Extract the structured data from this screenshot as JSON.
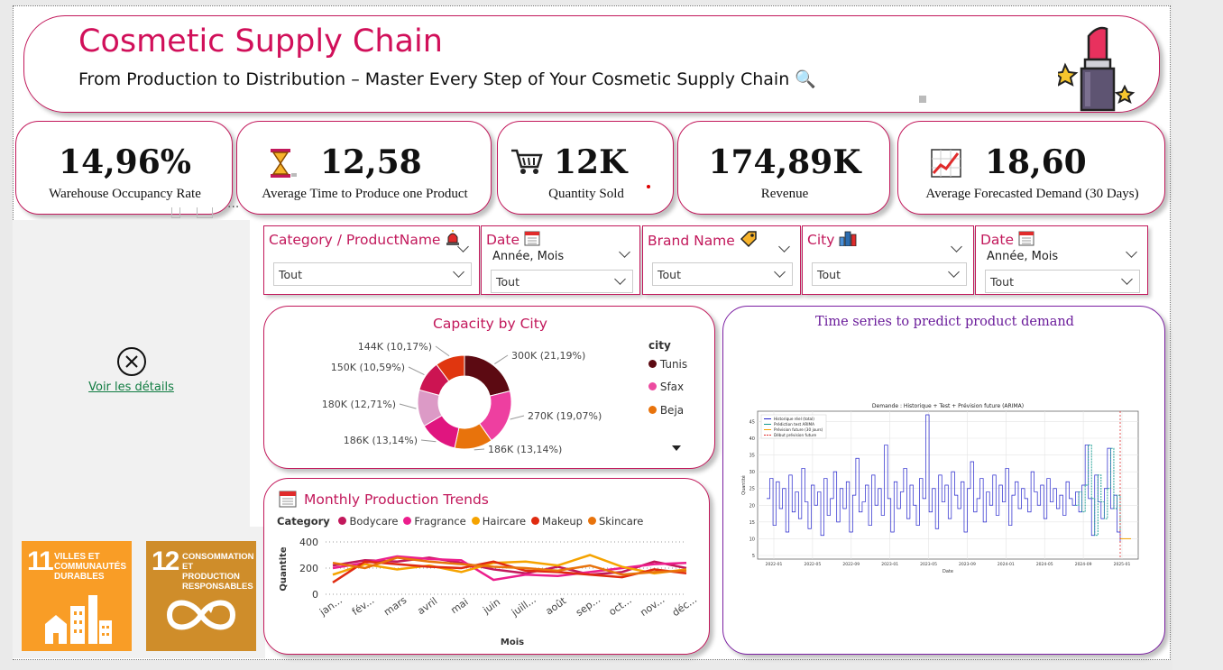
{
  "header": {
    "title": "Cosmetic Supply Chain",
    "subtitle": "From Production to Distribution – Master Every Step of Your Cosmetic Supply Chain 🔍"
  },
  "kpis": [
    {
      "value": "14,96%",
      "label": "Warehouse Occupancy Rate",
      "icon": "none"
    },
    {
      "value": "12,58",
      "label": "Average Time to Produce one Product",
      "icon": "hourglass-icon"
    },
    {
      "value": "12K",
      "label": "Quantity Sold",
      "icon": "cart-icon"
    },
    {
      "value": "174,89K",
      "label": "Revenue",
      "icon": "none"
    },
    {
      "value": "18,60",
      "label": "Average Forecasted Demand (30 Days)",
      "icon": "trend-chart-icon"
    }
  ],
  "details": {
    "link": "Voir les détails"
  },
  "slicers": [
    {
      "title": "Category / ProductName",
      "icon": "light-icon",
      "sub": "",
      "value": "Tout"
    },
    {
      "title": "Date",
      "icon": "calendar-icon",
      "sub": "Année, Mois",
      "value": "Tout"
    },
    {
      "title": "Brand Name",
      "icon": "tag-icon",
      "sub": "",
      "value": "Tout"
    },
    {
      "title": "City",
      "icon": "city-icon",
      "sub": "",
      "value": "Tout"
    },
    {
      "title": "Date",
      "icon": "calendar-icon",
      "sub": "Année, Mois",
      "value": "Tout"
    }
  ],
  "capacity": {
    "title": "Capacity by City",
    "legend_title": "city",
    "legend": [
      {
        "name": "Tunis",
        "color": "#5c0a12"
      },
      {
        "name": "Sfax",
        "color": "#ec4ba0"
      },
      {
        "name": "Beja",
        "color": "#e8730c"
      }
    ]
  },
  "timeseries": {
    "title": "Time series to predict product demand",
    "inner_title": "Demande : Historique + Test + Prévision future (ARIMA)",
    "legend": [
      "Historique réel (total)",
      "Prédiction test ARIMA",
      "Prévision future (30 jours)",
      "Début prévision future"
    ],
    "x_ticks": [
      "2022-01",
      "2022-05",
      "2022-09",
      "2023-01",
      "2023-05",
      "2023-09",
      "2024-01",
      "2024-05",
      "2024-09",
      "2025-01"
    ],
    "y_ticks": [
      "5",
      "10",
      "15",
      "20",
      "25",
      "30",
      "35",
      "40",
      "45"
    ],
    "xlabel": "Date",
    "ylabel": "Quantité"
  },
  "production": {
    "title": "Monthly Production Trends",
    "legend_title": "Category",
    "xlabel": "Mois",
    "ylabel": "Quantite"
  },
  "sdg": [
    {
      "number": "11",
      "text": "VILLES ET COMMUNAUTÉS DURABLES",
      "color": "#f99d26"
    },
    {
      "number": "12",
      "text": "CONSOMMATION ET PRODUCTION RESPONSABLES",
      "color": "#cf8d2a"
    }
  ],
  "chart_data": [
    {
      "type": "pie",
      "title": "Capacity by City",
      "donut": true,
      "slices": [
        {
          "label": "300K (21,19%)",
          "value": 300,
          "pct": 21.19,
          "color": "#5c0a12"
        },
        {
          "label": "270K (19,07%)",
          "value": 270,
          "pct": 19.07,
          "color": "#ee3fa0"
        },
        {
          "label": "186K (13,14%)",
          "value": 186,
          "pct": 13.14,
          "color": "#e8730c"
        },
        {
          "label": "186K (13,14%)",
          "value": 186,
          "pct": 13.14,
          "color": "#e0157f"
        },
        {
          "label": "180K (12,71%)",
          "value": 180,
          "pct": 12.71,
          "color": "#dc9ac6"
        },
        {
          "label": "150K (10,59%)",
          "value": 150,
          "pct": 10.59,
          "color": "#cc1452"
        },
        {
          "label": "144K (10,17%)",
          "value": 144,
          "pct": 10.17,
          "color": "#e0360f"
        }
      ],
      "legend": [
        "Tunis",
        "Sfax",
        "Beja"
      ]
    },
    {
      "type": "line",
      "title": "Monthly Production Trends",
      "xlabel": "Mois",
      "ylabel": "Quantite",
      "categories": [
        "jan...",
        "fév...",
        "mars",
        "avril",
        "mai",
        "juin",
        "juill...",
        "août",
        "sep...",
        "oct...",
        "nov...",
        "déc..."
      ],
      "ylim": [
        0,
        400
      ],
      "yticks": [
        0,
        200,
        400
      ],
      "series": [
        {
          "name": "Bodycare",
          "color": "#c2185b",
          "values": [
            220,
            260,
            250,
            280,
            240,
            190,
            160,
            210,
            150,
            170,
            250,
            200
          ]
        },
        {
          "name": "Fragrance",
          "color": "#ec1e8c",
          "values": [
            200,
            240,
            290,
            270,
            260,
            110,
            150,
            140,
            170,
            200,
            230,
            240
          ]
        },
        {
          "name": "Haircare",
          "color": "#f5a300",
          "values": [
            150,
            230,
            190,
            220,
            170,
            240,
            250,
            220,
            300,
            210,
            160,
            190
          ]
        },
        {
          "name": "Makeup",
          "color": "#e02b10",
          "values": [
            90,
            250,
            230,
            210,
            200,
            250,
            180,
            170,
            150,
            130,
            190,
            160
          ]
        },
        {
          "name": "Skincare",
          "color": "#e8730c",
          "values": [
            240,
            200,
            280,
            250,
            230,
            210,
            200,
            180,
            220,
            150,
            170,
            180
          ]
        }
      ]
    },
    {
      "type": "line",
      "title": "Demande : Historique + Test + Prévision future (ARIMA)",
      "xlabel": "Date",
      "ylabel": "Quantité",
      "ylim": [
        5,
        47
      ],
      "x_ticks": [
        "2022-01",
        "2022-05",
        "2022-09",
        "2023-01",
        "2023-05",
        "2023-09",
        "2024-01",
        "2024-05",
        "2024-09",
        "2025-01"
      ],
      "series": [
        {
          "name": "Historique réel (total)",
          "color": "#2222cc",
          "values": [
            22,
            28,
            14,
            27,
            19,
            25,
            12,
            29,
            18,
            24,
            16,
            31,
            21,
            13,
            26,
            20,
            24,
            11,
            28,
            17,
            22,
            30,
            15,
            25,
            19,
            27,
            12,
            23,
            34,
            18,
            21,
            26,
            14,
            29,
            20,
            25,
            17,
            38,
            22,
            12,
            27,
            19,
            24,
            31,
            16,
            26,
            20,
            14,
            28,
            22,
            47,
            18,
            25,
            13,
            29,
            21,
            26,
            16,
            30,
            23,
            19,
            27,
            12,
            25,
            33,
            18,
            22,
            28,
            15,
            24,
            20,
            29,
            17,
            26,
            21,
            31,
            14,
            23,
            27,
            19,
            25,
            22,
            18,
            30,
            24,
            20,
            26,
            16,
            28,
            21,
            25,
            19,
            23,
            17,
            27,
            22,
            20,
            24,
            18,
            26,
            38,
            22,
            11,
            29,
            21,
            16,
            25,
            37,
            19,
            23,
            12,
            9
          ]
        },
        {
          "name": "Prédiction test ARIMA",
          "color": "#11998e",
          "values": [
            20,
            24,
            18,
            26,
            38,
            22,
            11,
            29,
            21,
            16,
            25,
            37,
            19,
            23,
            12
          ]
        },
        {
          "name": "Prévision future (30 jours)",
          "color": "#f5a300",
          "values": [
            10,
            10,
            10
          ]
        }
      ]
    }
  ]
}
